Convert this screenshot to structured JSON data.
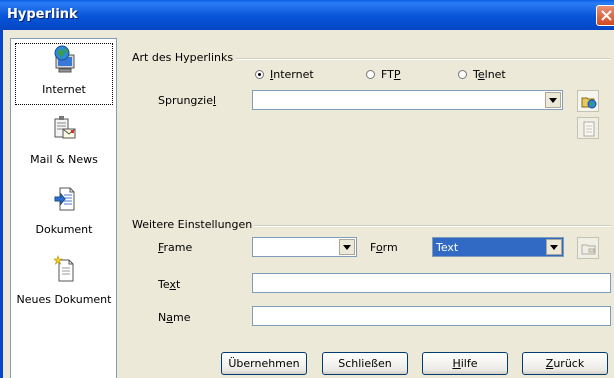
{
  "window": {
    "title": "Hyperlink"
  },
  "sidebar": {
    "items": [
      {
        "label": "Internet",
        "icon": "globe-computer-icon",
        "active": true
      },
      {
        "label": "Mail & News",
        "icon": "mail-news-icon",
        "active": false
      },
      {
        "label": "Dokument",
        "icon": "document-icon",
        "active": false
      },
      {
        "label": "Neues Dokument",
        "icon": "new-document-icon",
        "active": false
      }
    ]
  },
  "hyperlink_type": {
    "title": "Art des Hyperlinks",
    "options": [
      {
        "label": "Internet",
        "mnemonic": "I",
        "selected": true
      },
      {
        "label": "FTP",
        "mnemonic": "P",
        "selected": false
      },
      {
        "label": "Telnet",
        "mnemonic": "e",
        "selected": false
      }
    ],
    "target_label": "Sprungziel",
    "target_mnemonic": "l",
    "target_value": ""
  },
  "further_settings": {
    "title": "Weitere Einstellungen",
    "frame_label": "Frame",
    "frame_mnemonic": "F",
    "frame_value": "",
    "form_label": "Form",
    "form_mnemonic": "o",
    "form_value": "Text",
    "text_label": "Text",
    "text_mnemonic": "x",
    "text_value": "",
    "name_label": "Name",
    "name_mnemonic": "a",
    "name_value": ""
  },
  "buttons": {
    "apply": "Übernehmen",
    "close": "Schließen",
    "help": "Hilfe",
    "back": "Zurück"
  },
  "colors": {
    "title_bar": "#0854d8",
    "dialog_bg": "#ece9d8",
    "selection": "#316ac5"
  }
}
